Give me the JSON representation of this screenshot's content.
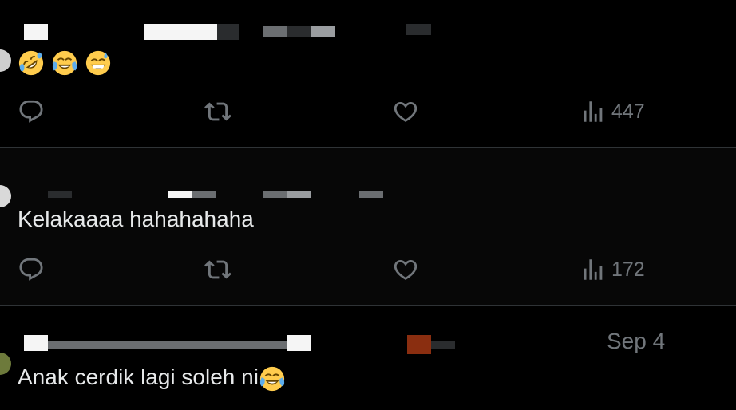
{
  "tweets": [
    {
      "text": "",
      "emojis": [
        "rolling-on-floor-laughing",
        "tears-of-joy",
        "grinning-sweat"
      ],
      "actions": {
        "reply_count": "",
        "retweet_count": "",
        "like_count": "",
        "view_count": "447"
      }
    },
    {
      "text": "Kelakaaaa hahahahaha",
      "actions": {
        "reply_count": "",
        "retweet_count": "",
        "like_count": "",
        "view_count": "172"
      }
    },
    {
      "date": "Sep 4",
      "text": "Anak cerdik lagi soleh ni",
      "emojis": [
        "tears-of-joy"
      ]
    }
  ],
  "colors": {
    "background": "#000000",
    "text": "#e7e9ea",
    "muted": "#71767b",
    "divider": "#2f3336"
  }
}
